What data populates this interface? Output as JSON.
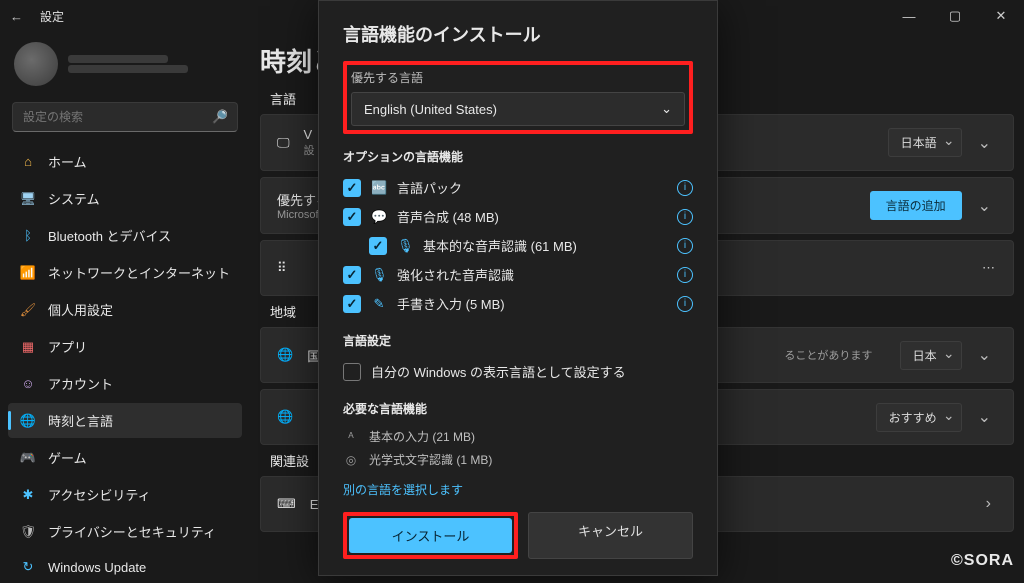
{
  "app": {
    "title": "設定"
  },
  "search": {
    "placeholder": "設定の検索"
  },
  "nav": {
    "home": "ホーム",
    "system": "システム",
    "bt": "Bluetooth とデバイス",
    "net": "ネットワークとインターネット",
    "pers": "個人用設定",
    "apps": "アプリ",
    "acct": "アカウント",
    "time": "時刻と言語",
    "game": "ゲーム",
    "acc": "アクセシビリティ",
    "priv": "プライバシーとセキュリティ",
    "upd": "Windows Update"
  },
  "main": {
    "title": "時刻と",
    "sec_lang": "言語",
    "row1_left": "V",
    "row1_sub": "設",
    "row1_drop": "日本語",
    "pref_label": "優先する",
    "pref_sub": "Microsoft",
    "add_lang": "言語の追加",
    "sec_region": "地域",
    "row_region_left": "国",
    "row_region_sub": "ることがあります",
    "row_region_drop": "日本",
    "row_region2_drop": "おすすめ",
    "sec_related": "関連設",
    "row_related_left": "E"
  },
  "dialog": {
    "title": "言語機能のインストール",
    "pref_label": "優先する言語",
    "selected": "English (United States)",
    "opt_header": "オプションの言語機能",
    "feat_pack": "言語パック",
    "feat_tts": "音声合成 (48 MB)",
    "feat_basic_speech": "基本的な音声認識 (61 MB)",
    "feat_enh_speech": "強化された音声認識",
    "feat_hand": "手書き入力 (5 MB)",
    "settings_header": "言語設定",
    "set_display": "自分の Windows の表示言語として設定する",
    "req_header": "必要な言語機能",
    "req_basic": "基本の入力 (21 MB)",
    "req_ocr": "光学式文字認識 (1 MB)",
    "another": "別の言語を選択します",
    "install": "インストール",
    "cancel": "キャンセル"
  },
  "watermark": "©SORA"
}
